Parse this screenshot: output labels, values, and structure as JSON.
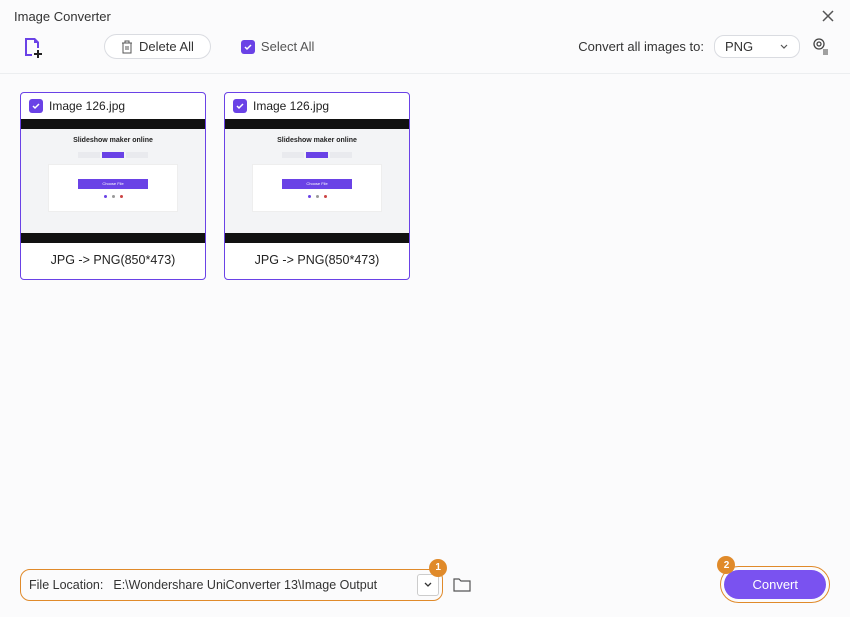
{
  "window": {
    "title": "Image Converter"
  },
  "toolbar": {
    "delete_all": "Delete All",
    "select_all": "Select All",
    "convert_to_label": "Convert all images to:",
    "format": "PNG"
  },
  "images": [
    {
      "filename": "Image 126.jpg",
      "conversion_info": "JPG -> PNG(850*473)",
      "thumb_caption": "Slideshow maker online",
      "thumb_btn": "Choose File"
    },
    {
      "filename": "Image 126.jpg",
      "conversion_info": "JPG -> PNG(850*473)",
      "thumb_caption": "Slideshow maker online",
      "thumb_btn": "Choose File"
    }
  ],
  "bottom": {
    "location_label": "File Location:",
    "location_path": "E:\\Wondershare UniConverter 13\\Image Output",
    "convert_label": "Convert",
    "step1": "1",
    "step2": "2"
  }
}
